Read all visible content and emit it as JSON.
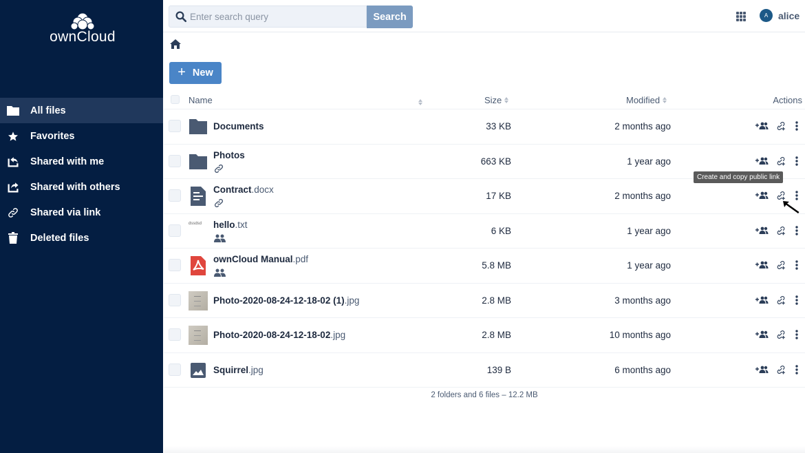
{
  "app": {
    "logo_text": "ownCloud"
  },
  "sidebar": {
    "items": [
      {
        "label": "All files",
        "icon": "folder-icon",
        "active": true
      },
      {
        "label": "Favorites",
        "icon": "star-icon"
      },
      {
        "label": "Shared with me",
        "icon": "shared-with-me-icon"
      },
      {
        "label": "Shared with others",
        "icon": "shared-with-others-icon"
      },
      {
        "label": "Shared via link",
        "icon": "link-icon"
      },
      {
        "label": "Deleted files",
        "icon": "trash-icon"
      }
    ]
  },
  "topbar": {
    "search_placeholder": "Enter search query",
    "search_value": "",
    "search_button": "Search",
    "user_initial": "A",
    "username": "alice"
  },
  "toolbar": {
    "new_label": "New"
  },
  "table": {
    "columns": {
      "name": "Name",
      "size": "Size",
      "modified": "Modified",
      "actions": "Actions"
    },
    "rows": [
      {
        "base": "Documents",
        "ext": "",
        "type": "folder",
        "indicator": "",
        "size": "33 KB",
        "modified": "2 months ago"
      },
      {
        "base": "Photos",
        "ext": "",
        "type": "folder",
        "indicator": "link",
        "size": "663 KB",
        "modified": "1 year ago"
      },
      {
        "base": "Contract",
        "ext": ".docx",
        "type": "document",
        "indicator": "link",
        "size": "17 KB",
        "modified": "2 months ago"
      },
      {
        "base": "hello",
        "ext": ".txt",
        "type": "text",
        "thumb_text": "dssdsd",
        "indicator": "users",
        "size": "6 KB",
        "modified": "1 year ago"
      },
      {
        "base": "ownCloud Manual",
        "ext": ".pdf",
        "type": "pdf",
        "indicator": "users",
        "size": "5.8 MB",
        "modified": "1 year ago"
      },
      {
        "base": "Photo-2020-08-24-12-18-02 (1)",
        "ext": ".jpg",
        "type": "photo",
        "indicator": "",
        "size": "2.8 MB",
        "modified": "3 months ago"
      },
      {
        "base": "Photo-2020-08-24-12-18-02",
        "ext": ".jpg",
        "type": "photo",
        "indicator": "",
        "size": "2.8 MB",
        "modified": "10 months ago"
      },
      {
        "base": "Squirrel",
        "ext": ".jpg",
        "type": "image",
        "indicator": "",
        "size": "139 B",
        "modified": "6 months ago"
      }
    ],
    "footer": "2 folders and 6 files – 12.2 MB"
  },
  "tooltip": "Create and copy public link",
  "colors": {
    "sidebar_bg": "#041e42",
    "sidebar_active": "#20385c",
    "primary": "#4a85c7",
    "search_button": "#7b9bc0",
    "icon": "#4a5a72",
    "pdf": "#e0463d",
    "avatar": "#1c5987"
  }
}
